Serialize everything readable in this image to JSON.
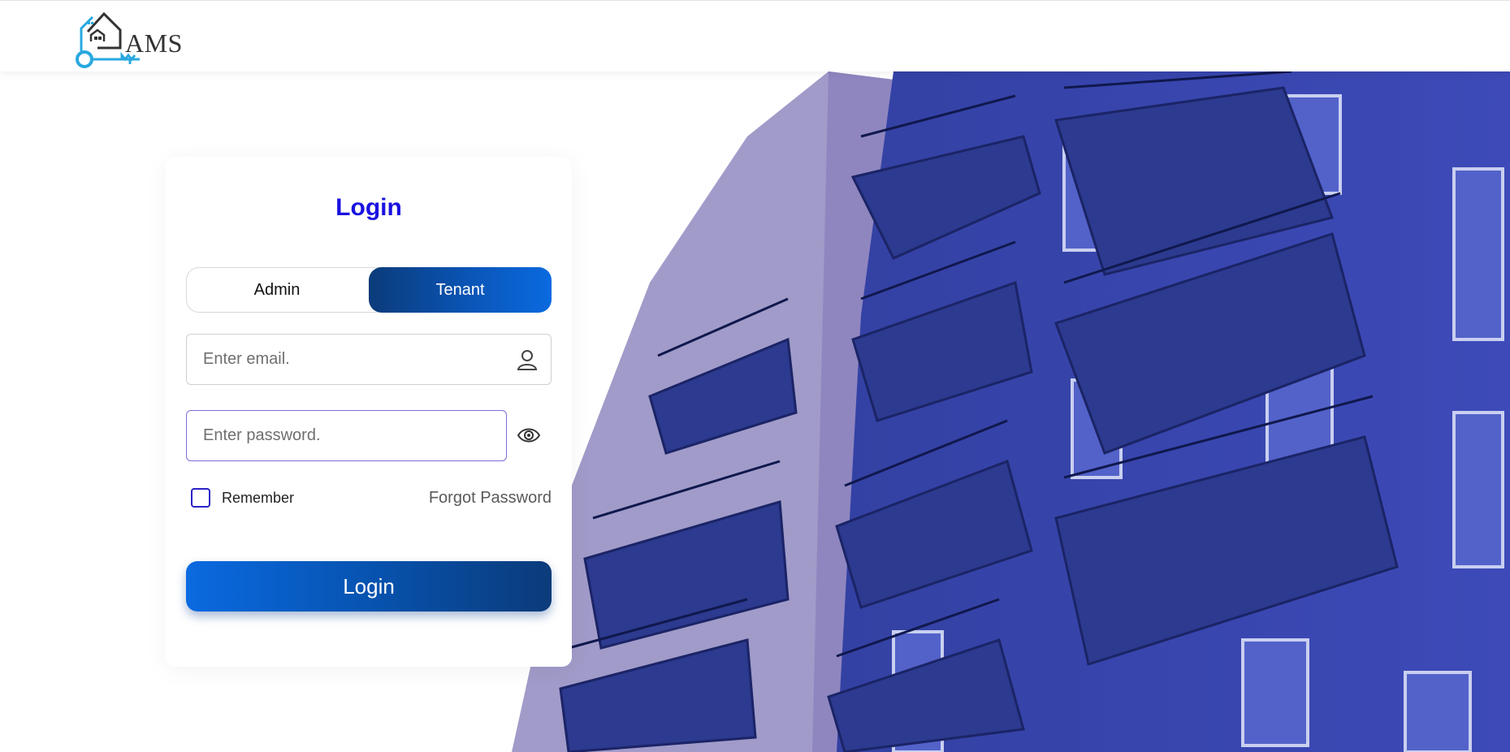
{
  "header": {
    "logo_text": "AMS",
    "logo_icon": "house-key-logo-icon"
  },
  "login": {
    "title": "Login",
    "roles": [
      {
        "label": "Admin",
        "selected": false
      },
      {
        "label": "Tenant",
        "selected": true
      }
    ],
    "email": {
      "value": "",
      "placeholder": "Enter email.",
      "icon": "user-icon"
    },
    "password": {
      "value": "",
      "placeholder": "Enter password.",
      "icon": "eye-icon"
    },
    "remember": {
      "label": "Remember",
      "checked": false
    },
    "forgot_label": "Forgot Password",
    "submit_label": "Login"
  },
  "colors": {
    "accent": "#1a12e0",
    "button_dark": "#0b3b7a",
    "button_light": "#0a6ae0",
    "background_tint": "#3a46b0"
  }
}
